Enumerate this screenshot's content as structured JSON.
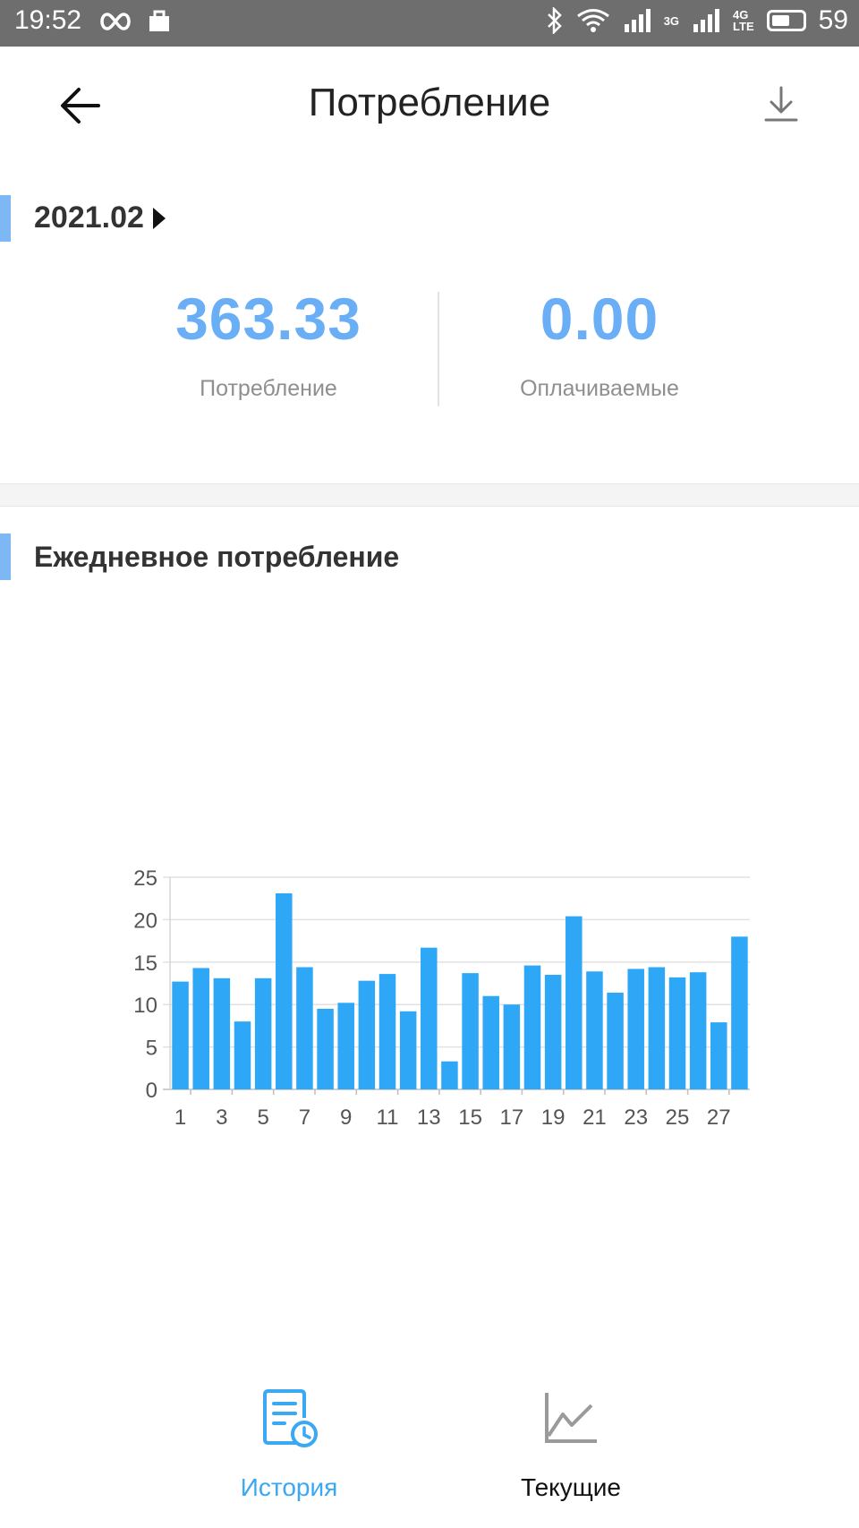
{
  "status_bar": {
    "time": "19:52",
    "net_3g": "3G",
    "net_4g": "4G",
    "net_lte": "LTE",
    "battery_level": "59"
  },
  "header": {
    "title": "Потребление"
  },
  "period": {
    "label": "2021.02"
  },
  "summary": {
    "consumption_value": "363.33",
    "consumption_label": "Потребление",
    "billable_value": "0.00",
    "billable_label": "Оплачиваемые"
  },
  "daily": {
    "title": "Ежедневное потребление"
  },
  "chart_data": {
    "type": "bar",
    "categories": [
      "1",
      "2",
      "3",
      "4",
      "5",
      "6",
      "7",
      "8",
      "9",
      "10",
      "11",
      "12",
      "13",
      "14",
      "15",
      "16",
      "17",
      "18",
      "19",
      "20",
      "21",
      "22",
      "23",
      "24",
      "25",
      "26",
      "27",
      "28"
    ],
    "tick_labels": [
      "1",
      "3",
      "5",
      "7",
      "9",
      "11",
      "13",
      "15",
      "17",
      "19",
      "21",
      "23",
      "25",
      "27"
    ],
    "values": [
      12.7,
      14.3,
      13.1,
      8.0,
      13.1,
      23.1,
      14.4,
      9.5,
      10.2,
      12.8,
      13.6,
      9.2,
      16.7,
      3.3,
      13.7,
      11.0,
      10.0,
      14.6,
      13.5,
      20.4,
      13.9,
      11.4,
      14.2,
      14.4,
      13.2,
      13.8,
      7.9,
      18.0
    ],
    "yticks": [
      0,
      5,
      10,
      15,
      20,
      25
    ],
    "ylim": [
      0,
      25
    ],
    "bar_color": "#2ea7f7",
    "grid": true
  },
  "nav": {
    "history_label": "История",
    "current_label": "Текущие"
  },
  "colors": {
    "accent": "#6aaef5",
    "active_tab": "#3aa8f3"
  }
}
